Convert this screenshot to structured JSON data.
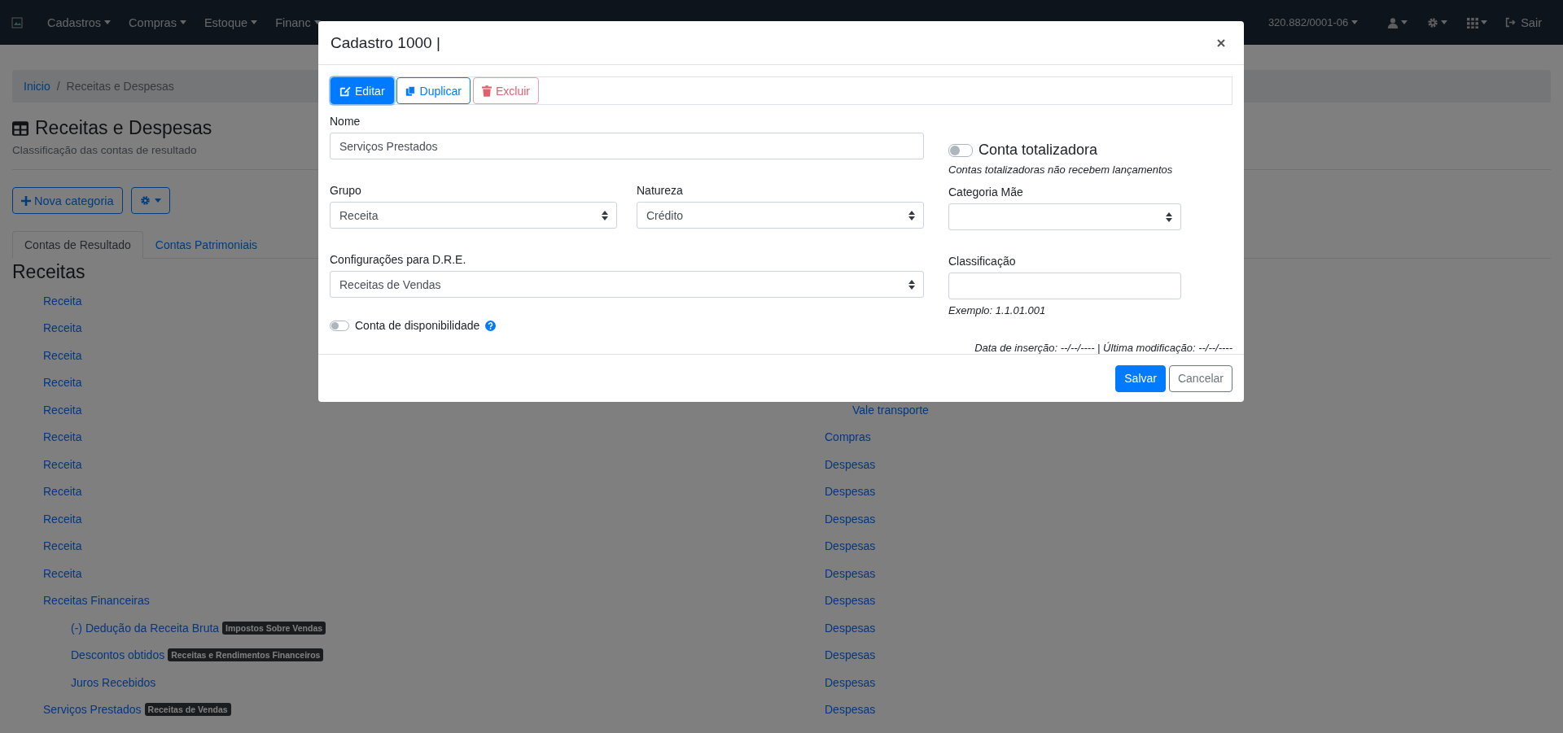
{
  "navbar": {
    "menus": [
      {
        "label": "Cadastros"
      },
      {
        "label": "Compras"
      },
      {
        "label": "Estoque"
      },
      {
        "label": "Financ"
      }
    ],
    "company": "320.882/0001-06",
    "logout": "Sair"
  },
  "breadcrumb": [
    {
      "label": "Inicio",
      "link": true
    },
    {
      "separator": "/",
      "label": "Receitas e Despesas",
      "link": false
    }
  ],
  "page": {
    "title": "Receitas e Despesas",
    "subtitle": "Classificação das contas de resultado",
    "new_button": "Nova categoria"
  },
  "tabs": [
    {
      "label": "Contas de Resultado",
      "selected": true
    },
    {
      "label": "Contas Patrimoniais",
      "selected": false
    }
  ],
  "section_title": "Receitas",
  "left_tree": [
    {
      "label": "Receita"
    },
    {
      "label": "Receita"
    },
    {
      "label": "Receita"
    },
    {
      "label": "Receita"
    },
    {
      "label": "Receita"
    },
    {
      "label": "Receita"
    },
    {
      "label": "Receita"
    },
    {
      "label": "Receita"
    },
    {
      "label": "Receita"
    },
    {
      "label": "Receita"
    },
    {
      "label": "Receita"
    },
    {
      "label": "Receitas Financeiras",
      "children": [
        {
          "label": "(-) Dedução da Receita Bruta",
          "badge": "Impostos Sobre Vendas"
        },
        {
          "label": "Descontos obtidos",
          "badge": "Receitas e Rendimentos Financeiros"
        },
        {
          "label": "Juros Recebidos"
        }
      ]
    },
    {
      "label": "Serviços Prestados",
      "badge": "Receitas de Vendas"
    }
  ],
  "right_tree": [
    {
      "children": [
        {
          "label": "Vale transporte"
        }
      ]
    },
    {
      "label": "Compras"
    },
    {
      "label": "Despesas"
    },
    {
      "label": "Despesas"
    },
    {
      "label": "Despesas"
    },
    {
      "label": "Despesas"
    },
    {
      "label": "Despesas"
    },
    {
      "label": "Despesas"
    },
    {
      "label": "Despesas"
    },
    {
      "label": "Despesas"
    },
    {
      "label": "Despesas"
    },
    {
      "label": "Despesas"
    }
  ],
  "modal": {
    "title": "Cadastro 1000 |",
    "actions": [
      {
        "label": "Editar",
        "kind": "edit"
      },
      {
        "label": "Duplicar",
        "kind": "duplicate"
      },
      {
        "label": "Excluir",
        "kind": "delete"
      }
    ],
    "nome": {
      "label": "Nome",
      "value": "Serviços Prestados"
    },
    "totalizadora": {
      "label": "Conta totalizadora",
      "on": false,
      "hint": "Contas totalizadoras não recebem lançamentos"
    },
    "grupo": {
      "label": "Grupo",
      "value": "Receita"
    },
    "natureza": {
      "label": "Natureza",
      "value": "Crédito"
    },
    "categoria_mae": {
      "label": "Categoria Mãe"
    },
    "dre": {
      "label": "Configurações para D.R.E.",
      "value": "Receitas de Vendas"
    },
    "classificacao": {
      "label": "Classificação",
      "hint": "Exemplo: 1.1.01.001"
    },
    "disponibilidade": {
      "label": "Conta de disponibilidade",
      "on": false
    },
    "meta": "Data de inserção: --/--/---- | Última modificação: --/--/----",
    "save": "Salvar",
    "cancel": "Cancelar"
  }
}
